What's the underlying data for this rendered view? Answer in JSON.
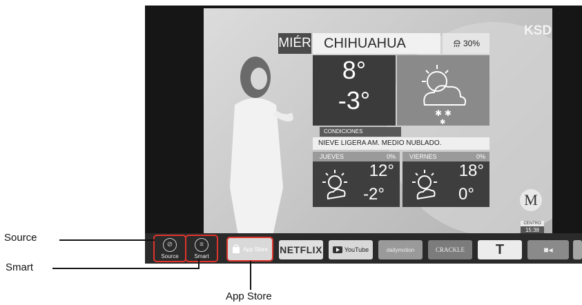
{
  "weather": {
    "day": "MIÉR",
    "city": "CHIHUAHUA",
    "precip_chance": "30%",
    "high": "8°",
    "low": "-3°",
    "conditions_title": "CONDICIONES",
    "conditions_text": "NIEVE LIGERA AM. MEDIO NUBLADO.",
    "forecast": [
      {
        "day": "JUEVES",
        "pop": "0%",
        "high": "12°",
        "low": "-2°"
      },
      {
        "day": "VIERNES",
        "pop": "0%",
        "high": "18°",
        "low": "0°"
      }
    ],
    "channel": "KSDY",
    "logo_letter": "M",
    "centro_label": "CENTRO",
    "centro_time": "15:38"
  },
  "appbar": {
    "source_label": "Source",
    "smart_label": "Smart",
    "app_store_label": "App Store",
    "netflix_label": "NETFLIX",
    "youtube_label": "YouTube",
    "dailymotion_label": "dailymotion",
    "crackle_label": "CRACKLE",
    "tubi_label": "T",
    "icons": {
      "source": "source-icon",
      "smart": "smart-icon",
      "app_store": "shopping-bag-icon",
      "video": "video-camera-icon"
    }
  },
  "callouts": {
    "source": "Source",
    "smart": "Smart",
    "app_store": "App Store"
  },
  "colors": {
    "highlight": "#e0342b",
    "appbar_bg": "#2a2a2a"
  }
}
